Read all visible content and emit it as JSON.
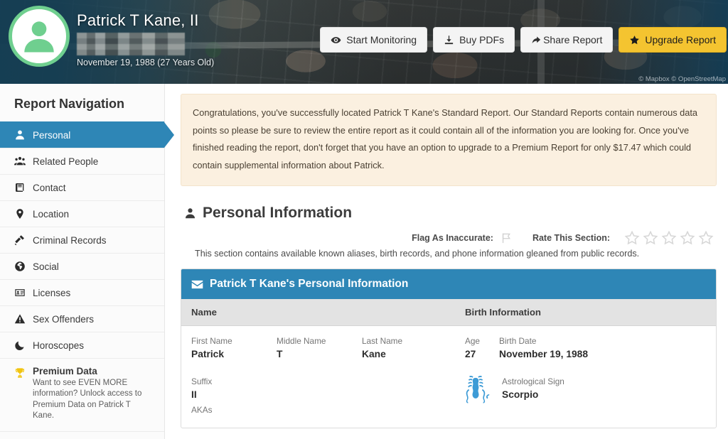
{
  "header": {
    "person_name": "Patrick T Kane, II",
    "dob_line": "November 19, 1988 (27 Years Old)",
    "map_attribution": "© Mapbox © OpenStreetMap",
    "buttons": [
      {
        "label": "Start Monitoring",
        "icon": "eye-icon",
        "style": "light"
      },
      {
        "label": "Buy PDFs",
        "icon": "download-icon",
        "style": "light"
      },
      {
        "label": "Share Report",
        "icon": "share-icon",
        "style": "light"
      },
      {
        "label": "Upgrade Report",
        "icon": "star-icon",
        "style": "gold"
      }
    ]
  },
  "sidebar": {
    "title": "Report Navigation",
    "items": [
      {
        "label": "Personal",
        "icon": "user-icon",
        "active": true
      },
      {
        "label": "Related People",
        "icon": "users-icon",
        "active": false
      },
      {
        "label": "Contact",
        "icon": "book-icon",
        "active": false
      },
      {
        "label": "Location",
        "icon": "map-pin-icon",
        "active": false
      },
      {
        "label": "Criminal Records",
        "icon": "gavel-icon",
        "active": false
      },
      {
        "label": "Social",
        "icon": "globe-icon",
        "active": false
      },
      {
        "label": "Licenses",
        "icon": "id-card-icon",
        "active": false
      },
      {
        "label": "Sex Offenders",
        "icon": "warning-triangle-icon",
        "active": false
      },
      {
        "label": "Horoscopes",
        "icon": "moon-icon",
        "active": false
      }
    ],
    "premium": {
      "title": "Premium Data",
      "description": "Want to see EVEN MORE information? Unlock access to Premium Data on Patrick T Kane.",
      "icon": "trophy-icon"
    }
  },
  "main": {
    "alert_text": "Congratulations, you've successfully located Patrick T Kane's Standard Report. Our Standard Reports contain numerous data points so please be sure to review the entire report as it could contain all of the information you are looking for. Once you've finished reading the report, don't forget that you have an option to upgrade to a Premium Report for only $17.47 which could contain supplemental information about Patrick.",
    "section_title": "Personal Information",
    "flag_label": "Flag As Inaccurate:",
    "rate_label": "Rate This Section:",
    "star_count": 5,
    "stars_filled": 0,
    "section_description": "This section contains available known aliases, birth records, and phone information gleaned from public records.",
    "panel": {
      "title": "Patrick T Kane's Personal Information",
      "group_headers": {
        "left": "Name",
        "right": "Birth Information"
      },
      "fields": {
        "first_name": {
          "label": "First Name",
          "value": "Patrick"
        },
        "middle_name": {
          "label": "Middle Name",
          "value": "T"
        },
        "last_name": {
          "label": "Last Name",
          "value": "Kane"
        },
        "age": {
          "label": "Age",
          "value": "27"
        },
        "birth_date": {
          "label": "Birth Date",
          "value": "November 19, 1988"
        },
        "suffix": {
          "label": "Suffix",
          "value": "II"
        },
        "astrological_sign": {
          "label": "Astrological Sign",
          "value": "Scorpio",
          "icon": "scorpion-icon"
        },
        "akas": {
          "label": "AKAs",
          "value": ""
        }
      }
    }
  },
  "colors": {
    "accent_blue": "#2e86b6",
    "gold": "#f4c430",
    "avatar_green": "#6fcf8f",
    "alert_bg": "#fbf0e0",
    "zodiac_blue": "#3d9bd6"
  }
}
